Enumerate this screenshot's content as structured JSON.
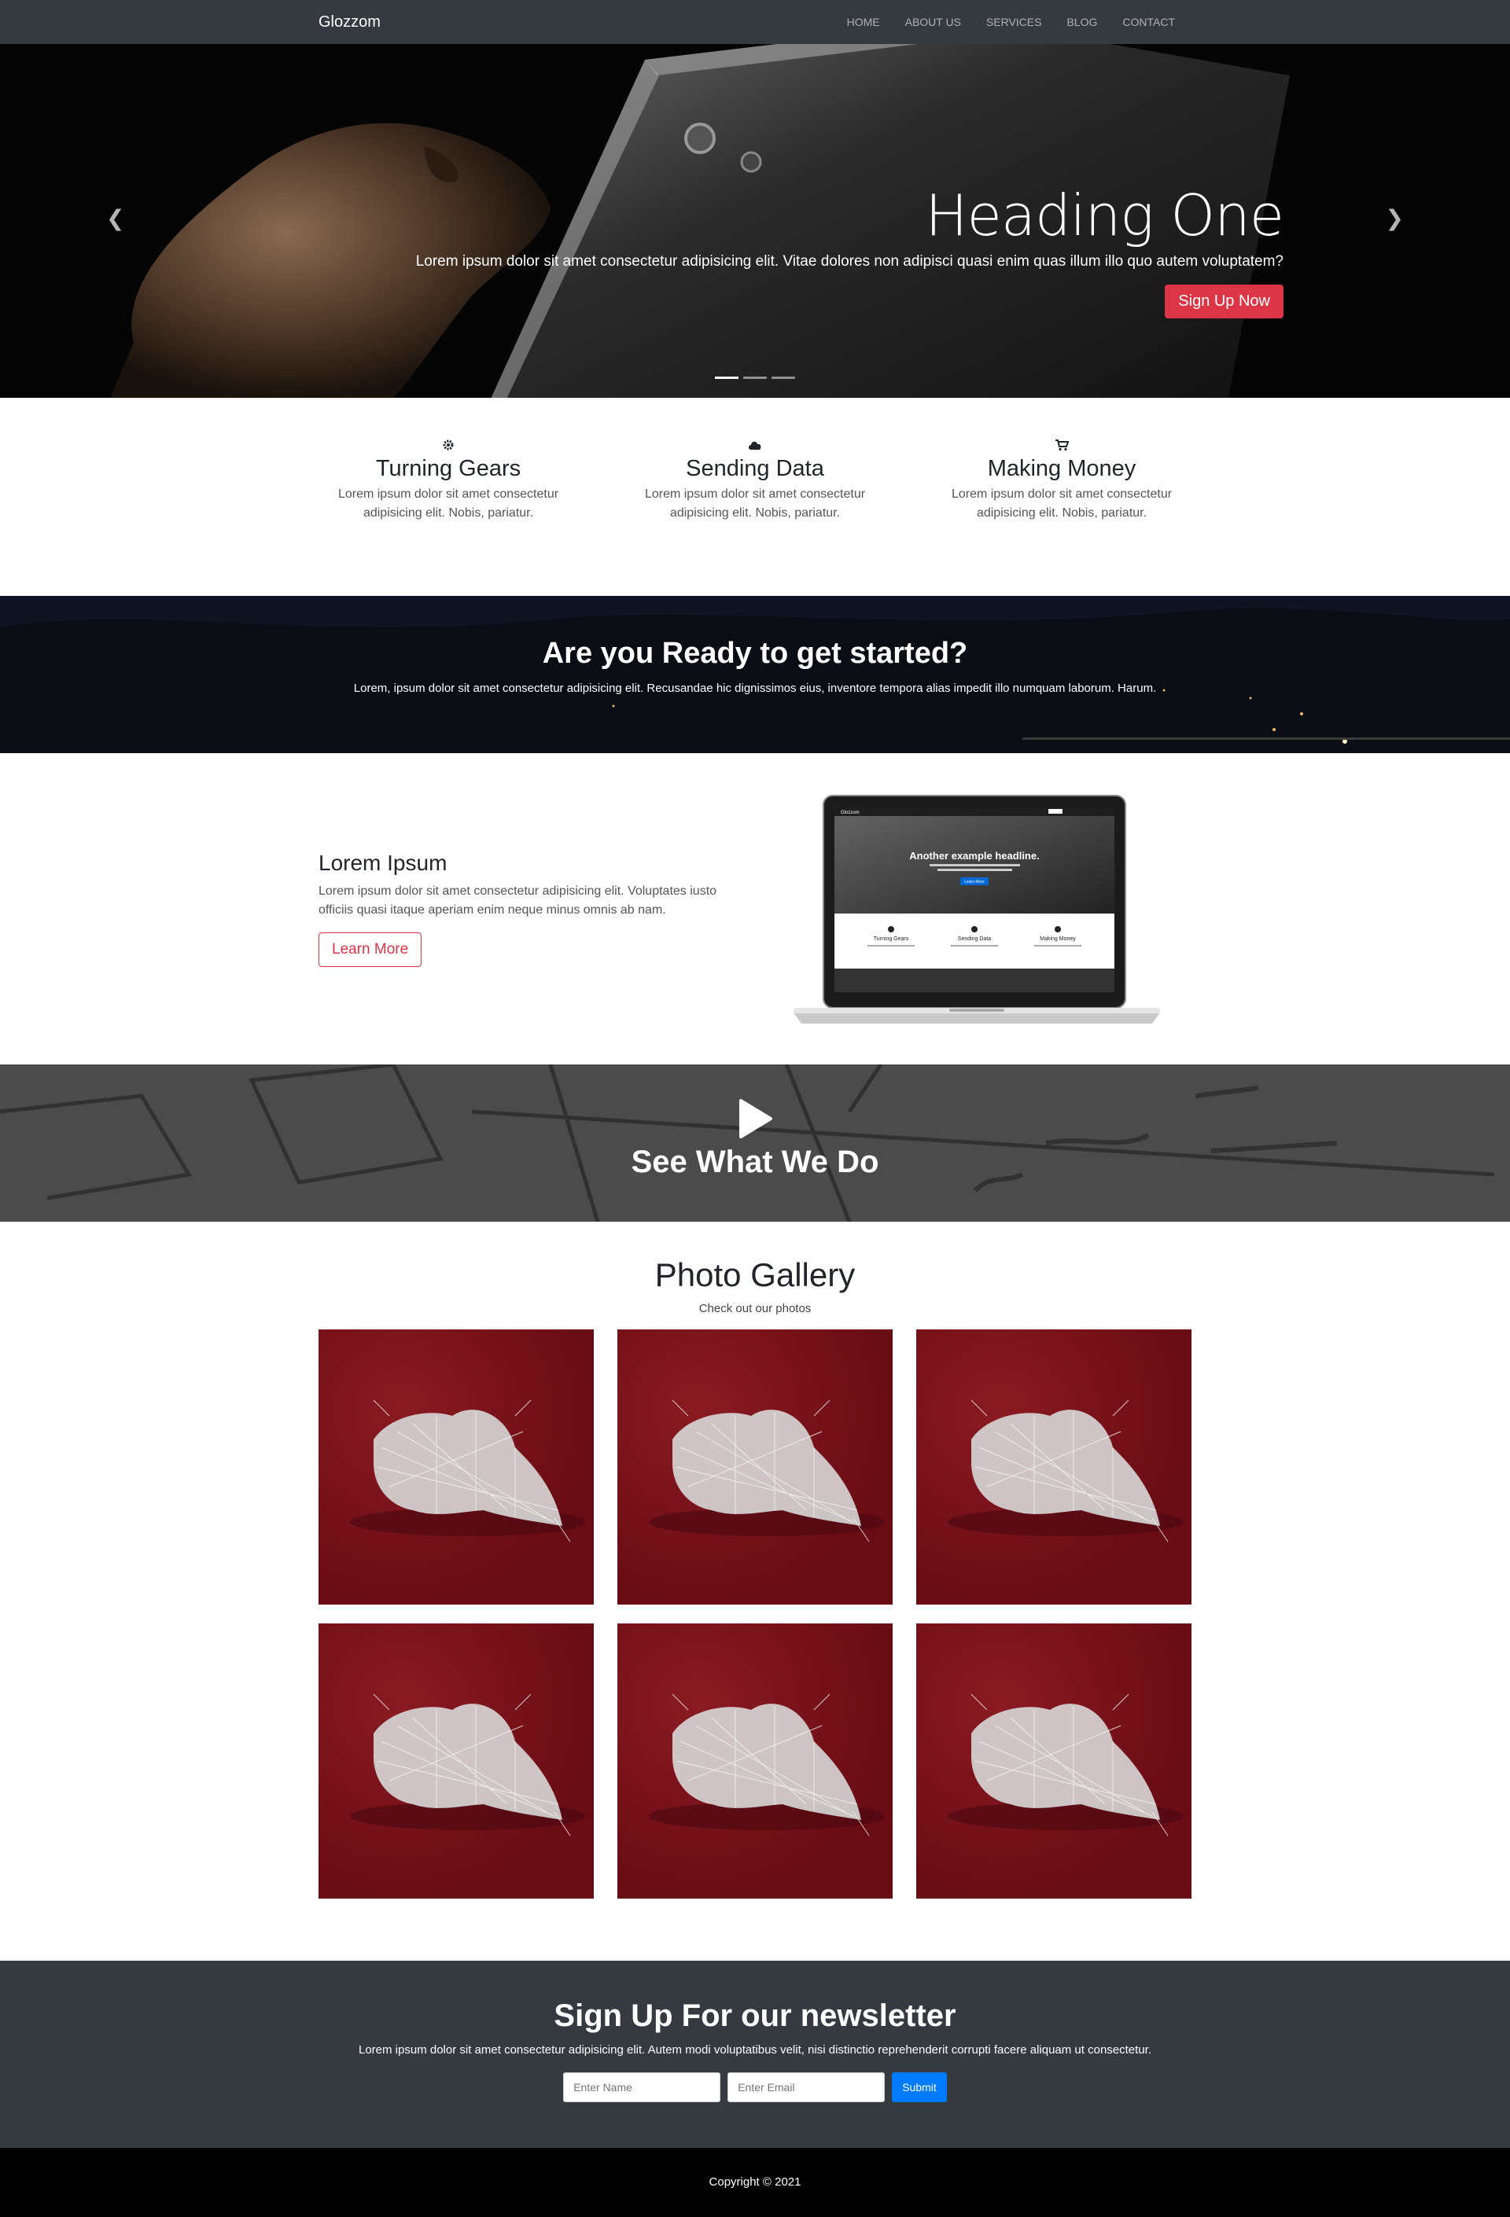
{
  "nav": {
    "brand": "Glozzom",
    "links": [
      "HOME",
      "ABOUT US",
      "SERVICES",
      "BLOG",
      "CONTACT"
    ]
  },
  "hero": {
    "heading": "Heading One",
    "text": "Lorem ipsum dolor sit amet consectetur adipisicing elit. Vitae dolores non adipisci quasi enim quas illum illo quo autem voluptatem?",
    "button": "Sign Up Now",
    "slide_count": 3,
    "active_slide": 1
  },
  "features": [
    {
      "icon": "gear-icon",
      "title": "Turning Gears",
      "text": "Lorem ipsum dolor sit amet consectetur adipisicing elit. Nobis, pariatur."
    },
    {
      "icon": "cloud-icon",
      "title": "Sending Data",
      "text": "Lorem ipsum dolor sit amet consectetur adipisicing elit. Nobis, pariatur."
    },
    {
      "icon": "cart-icon",
      "title": "Making Money",
      "text": "Lorem ipsum dolor sit amet consectetur adipisicing elit. Nobis, pariatur."
    }
  ],
  "cta": {
    "heading": "Are you Ready to get started?",
    "text": "Lorem, ipsum dolor sit amet consectetur adipisicing elit. Recusandae hic dignissimos eius, inventore tempora alias impedit illo numquam laborum. Harum."
  },
  "about": {
    "heading": "Lorem Ipsum",
    "text": "Lorem ipsum dolor sit amet consectetur adipisicing elit. Voluptates iusto officiis quasi itaque aperiam enim neque minus omnis ab nam.",
    "button": "Learn More",
    "laptop_screen": {
      "brand": "Glozzom",
      "headline": "Another example headline.",
      "button": "Learn More",
      "features": [
        "Turning Gears",
        "Sending Data",
        "Making Money"
      ]
    }
  },
  "video": {
    "heading": "See What We Do"
  },
  "gallery": {
    "heading": "Photo Gallery",
    "subheading": "Check out our photos",
    "photo_count": 6
  },
  "newsletter": {
    "heading": "Sign Up For our newsletter",
    "text": "Lorem ipsum dolor sit amet consectetur adipisicing elit. Autem modi voluptatibus velit, nisi distinctio reprehenderit corrupti facere aliquam ut consectetur.",
    "name_placeholder": "Enter Name",
    "email_placeholder": "Enter Email",
    "submit": "Submit"
  },
  "footer": {
    "copyright": "Copyright © 2021"
  },
  "colors": {
    "navbar": "#343a40",
    "danger": "#dc3545",
    "primary": "#007bff",
    "photo_bg": "#7a111a"
  }
}
